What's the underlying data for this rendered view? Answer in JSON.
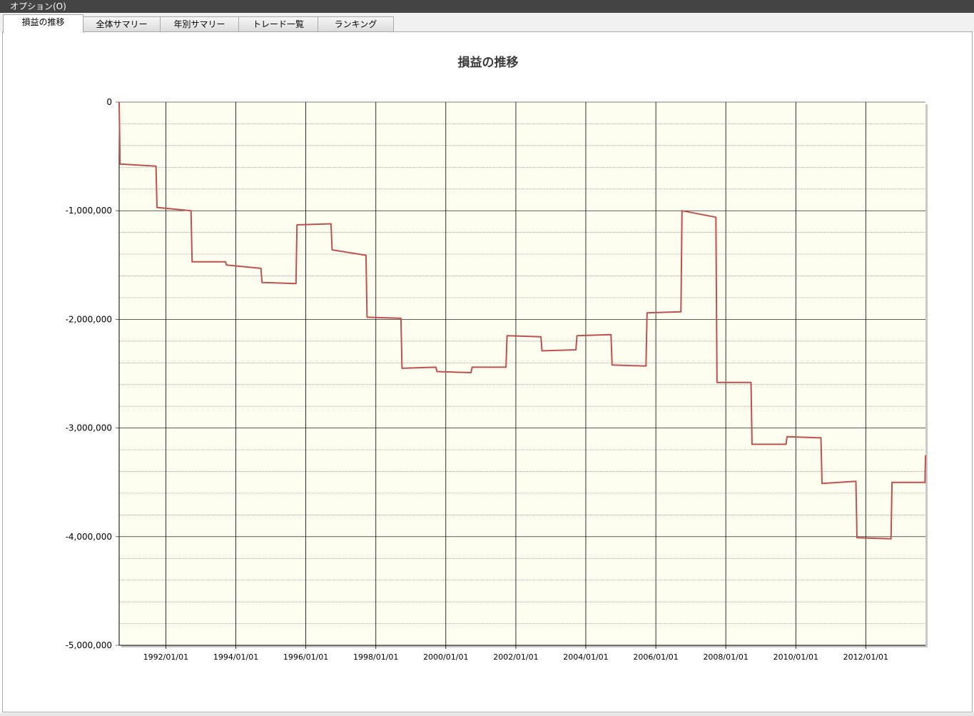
{
  "menubar": {
    "label": "オプション(O)"
  },
  "tabs": [
    {
      "label": "損益の推移",
      "active": true
    },
    {
      "label": "全体サマリー",
      "active": false
    },
    {
      "label": "年別サマリー",
      "active": false
    },
    {
      "label": "トレード一覧",
      "active": false
    },
    {
      "label": "ランキング",
      "active": false
    }
  ],
  "colors": {
    "plot_background": "#fdfdf0",
    "series_line": "#c0504d",
    "grid_major": "#000000",
    "grid_minor": "#888888"
  },
  "chart_data": {
    "type": "line",
    "title": "損益の推移",
    "xlabel": "",
    "ylabel": "",
    "ylim": [
      -5000000,
      0
    ],
    "xlim": [
      "1990-09-01",
      "2013-09-15"
    ],
    "grid": true,
    "legend": "none",
    "y_ticks": [
      "0",
      "-1,000,000",
      "-2,000,000",
      "-3,000,000",
      "-4,000,000",
      "-5,000,000"
    ],
    "y_tick_values": [
      0,
      -1000000,
      -2000000,
      -3000000,
      -4000000,
      -5000000
    ],
    "x_ticks": [
      "1992/01/01",
      "1994/01/01",
      "1996/01/01",
      "1998/01/01",
      "2000/01/01",
      "2002/01/01",
      "2004/01/01",
      "2006/01/01",
      "2008/01/01",
      "2010/01/01",
      "2012/01/01"
    ],
    "x_tick_dates": [
      "1992-01-01",
      "1994-01-01",
      "1996-01-01",
      "1998-01-01",
      "2000-01-01",
      "2002-01-01",
      "2004-01-01",
      "2006-01-01",
      "2008-01-01",
      "2010-01-01",
      "2012-01-01"
    ],
    "series": [
      {
        "values": [
          [
            "1990-09-01",
            0
          ],
          [
            "1990-09-10",
            -570000
          ],
          [
            "1991-09-20",
            -590000
          ],
          [
            "1991-10-01",
            -970000
          ],
          [
            "1992-09-20",
            -1000000
          ],
          [
            "1992-10-01",
            -1470000
          ],
          [
            "1993-09-15",
            -1470000
          ],
          [
            "1993-09-25",
            -1500000
          ],
          [
            "1994-09-20",
            -1530000
          ],
          [
            "1994-10-01",
            -1660000
          ],
          [
            "1995-09-20",
            -1670000
          ],
          [
            "1995-10-01",
            -1130000
          ],
          [
            "1996-09-20",
            -1120000
          ],
          [
            "1996-10-01",
            -1360000
          ],
          [
            "1997-09-20",
            -1410000
          ],
          [
            "1997-10-01",
            -1980000
          ],
          [
            "1998-09-20",
            -1990000
          ],
          [
            "1998-10-01",
            -2450000
          ],
          [
            "1999-09-20",
            -2440000
          ],
          [
            "1999-10-01",
            -2480000
          ],
          [
            "2000-09-20",
            -2490000
          ],
          [
            "2000-10-01",
            -2440000
          ],
          [
            "2001-09-20",
            -2440000
          ],
          [
            "2001-10-01",
            -2150000
          ],
          [
            "2002-09-20",
            -2160000
          ],
          [
            "2002-10-01",
            -2290000
          ],
          [
            "2003-09-20",
            -2280000
          ],
          [
            "2003-10-01",
            -2150000
          ],
          [
            "2004-09-20",
            -2140000
          ],
          [
            "2004-10-01",
            -2420000
          ],
          [
            "2005-09-20",
            -2430000
          ],
          [
            "2005-10-01",
            -1940000
          ],
          [
            "2006-09-20",
            -1930000
          ],
          [
            "2006-10-01",
            -1000000
          ],
          [
            "2007-09-20",
            -1060000
          ],
          [
            "2007-10-01",
            -2580000
          ],
          [
            "2008-09-20",
            -2580000
          ],
          [
            "2008-10-01",
            -3150000
          ],
          [
            "2009-09-20",
            -3150000
          ],
          [
            "2009-10-01",
            -3080000
          ],
          [
            "2010-09-20",
            -3090000
          ],
          [
            "2010-10-01",
            -3510000
          ],
          [
            "2011-09-20",
            -3490000
          ],
          [
            "2011-10-01",
            -4010000
          ],
          [
            "2012-09-20",
            -4020000
          ],
          [
            "2012-10-01",
            -3500000
          ],
          [
            "2013-09-10",
            -3500000
          ],
          [
            "2013-09-15",
            -3250000
          ]
        ]
      }
    ]
  }
}
